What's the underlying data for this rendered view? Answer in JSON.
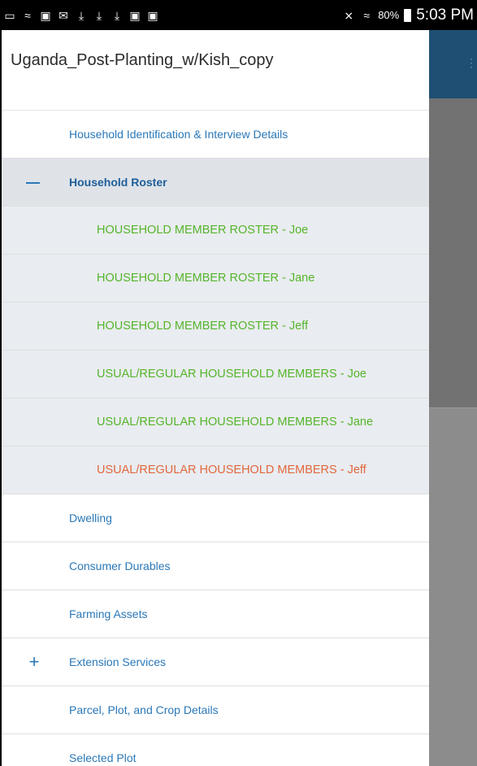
{
  "status_bar": {
    "battery": "80%",
    "time": "5:03 PM"
  },
  "drawer": {
    "title": "Uganda_Post-Planting_w/Kish_copy",
    "sections": [
      {
        "label": "Household Identification & Interview Details",
        "expanded": false,
        "toggle": ""
      },
      {
        "label": "Household Roster",
        "expanded": true,
        "toggle": "collapse",
        "children": [
          {
            "label": "HOUSEHOLD MEMBER ROSTER - Joe",
            "status": "complete"
          },
          {
            "label": "HOUSEHOLD MEMBER ROSTER - Jane",
            "status": "complete"
          },
          {
            "label": "HOUSEHOLD MEMBER ROSTER - Jeff",
            "status": "complete"
          },
          {
            "label": "USUAL/REGULAR  HOUSEHOLD MEMBERS - Joe",
            "status": "complete"
          },
          {
            "label": "USUAL/REGULAR  HOUSEHOLD MEMBERS - Jane",
            "status": "complete"
          },
          {
            "label": "USUAL/REGULAR  HOUSEHOLD MEMBERS - Jeff",
            "status": "error"
          }
        ]
      },
      {
        "label": "Dwelling",
        "expanded": false,
        "toggle": ""
      },
      {
        "label": "Consumer Durables",
        "expanded": false,
        "toggle": ""
      },
      {
        "label": "Farming Assets",
        "expanded": false,
        "toggle": ""
      },
      {
        "label": "Extension Services",
        "expanded": false,
        "toggle": "expand"
      },
      {
        "label": "Parcel, Plot, and Crop Details",
        "expanded": false,
        "toggle": ""
      },
      {
        "label": "Selected Plot",
        "expanded": false,
        "toggle": ""
      }
    ]
  },
  "colors": {
    "section_link": "#2a78b8",
    "complete": "#55b52a",
    "error": "#e2673e",
    "app_bar": "#1f4f73"
  }
}
